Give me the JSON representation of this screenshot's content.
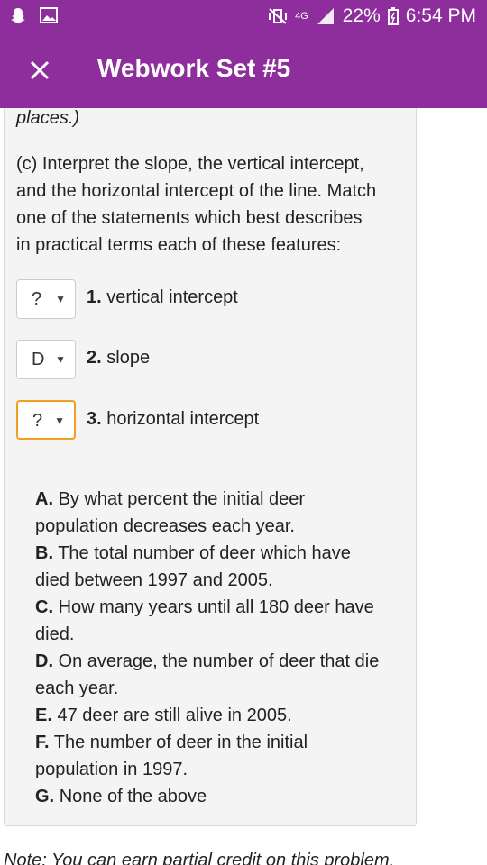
{
  "status_bar": {
    "battery": "22%",
    "time": "6:54 PM",
    "network": "4G",
    "icons": [
      "snapchat-icon",
      "image-icon",
      "mute-vibrate-icon",
      "data-icon",
      "signal-icon",
      "battery-icon"
    ]
  },
  "app_bar": {
    "title": "Webwork Set #5",
    "close_icon": "close-icon",
    "color": "#8e2e9d"
  },
  "problem": {
    "prev_text": "places.)",
    "part_c": [
      "(c) Interpret the slope, the vertical intercept,",
      "and the horizontal intercept of the line. Match",
      "one of the statements which best describes",
      "in practical terms each of these features:"
    ],
    "questions": [
      {
        "num": "1.",
        "label": "vertical intercept",
        "selected": "?"
      },
      {
        "num": "2.",
        "label": "slope",
        "selected": "D"
      },
      {
        "num": "3.",
        "label": "horizontal intercept",
        "selected": "?"
      }
    ],
    "options": [
      {
        "letter": "A.",
        "text_lines": [
          "By what percent the initial deer",
          "population decreases each year."
        ]
      },
      {
        "letter": "B.",
        "text_lines": [
          "The total number of deer which have",
          "died between 1997 and 2005."
        ]
      },
      {
        "letter": "C.",
        "text_lines": [
          "How many years until all 180 deer have",
          "died."
        ]
      },
      {
        "letter": "D.",
        "text_lines": [
          "On average, the number of deer that die",
          "each year."
        ]
      },
      {
        "letter": "E.",
        "text_lines": [
          "47 deer are still alive in 2005."
        ]
      },
      {
        "letter": "F.",
        "text_lines": [
          "The number of deer in the initial",
          "population in 1997."
        ]
      },
      {
        "letter": "G.",
        "text_lines": [
          "None of the above"
        ]
      }
    ],
    "note": "Note: You can earn partial credit on this problem."
  }
}
